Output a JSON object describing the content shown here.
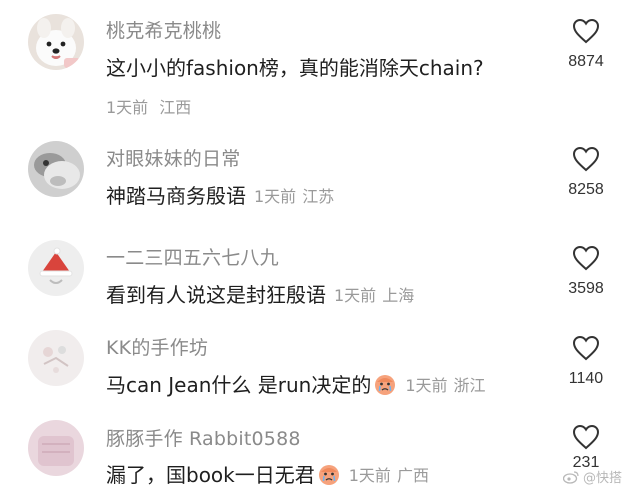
{
  "comments": [
    {
      "username": "桃克希克桃桃",
      "text": "这小小的fashion榜，真的能消除天chain?",
      "time": "1天前",
      "location": "江西",
      "likes": "8874",
      "avatar_icon": "white-dog-avatar"
    },
    {
      "username": "对眼妹妹的日常",
      "text": "神踏马商务殷语",
      "time": "1天前",
      "location": "江苏",
      "likes": "8258",
      "avatar_icon": "pet-photo-avatar"
    },
    {
      "username": "一二三四五六七八九",
      "text": "看到有人说这是封狂殷语",
      "time": "1天前",
      "location": "上海",
      "likes": "3598",
      "avatar_icon": "santa-hat-avatar"
    },
    {
      "username": "KK的手作坊",
      "text": "马can Jean什么 是run决定的",
      "time": "1天前",
      "location": "浙江",
      "likes": "1140",
      "avatar_icon": "craft-avatar",
      "emoji": "crying-face-emoji"
    },
    {
      "username": "豚豚手作 Rabbit0588",
      "text": "漏了，国book一日无君",
      "time": "1天前",
      "location": "广西",
      "likes": "231",
      "avatar_icon": "pink-craft-avatar",
      "emoji": "crying-face-emoji"
    }
  ],
  "watermark": {
    "text": "@快搭",
    "icon": "weibo-logo-icon"
  },
  "colors": {
    "username": "#8a8a8a",
    "meta": "#9a9a9a",
    "text": "#1f1f1f",
    "heart_stroke": "#333333"
  }
}
